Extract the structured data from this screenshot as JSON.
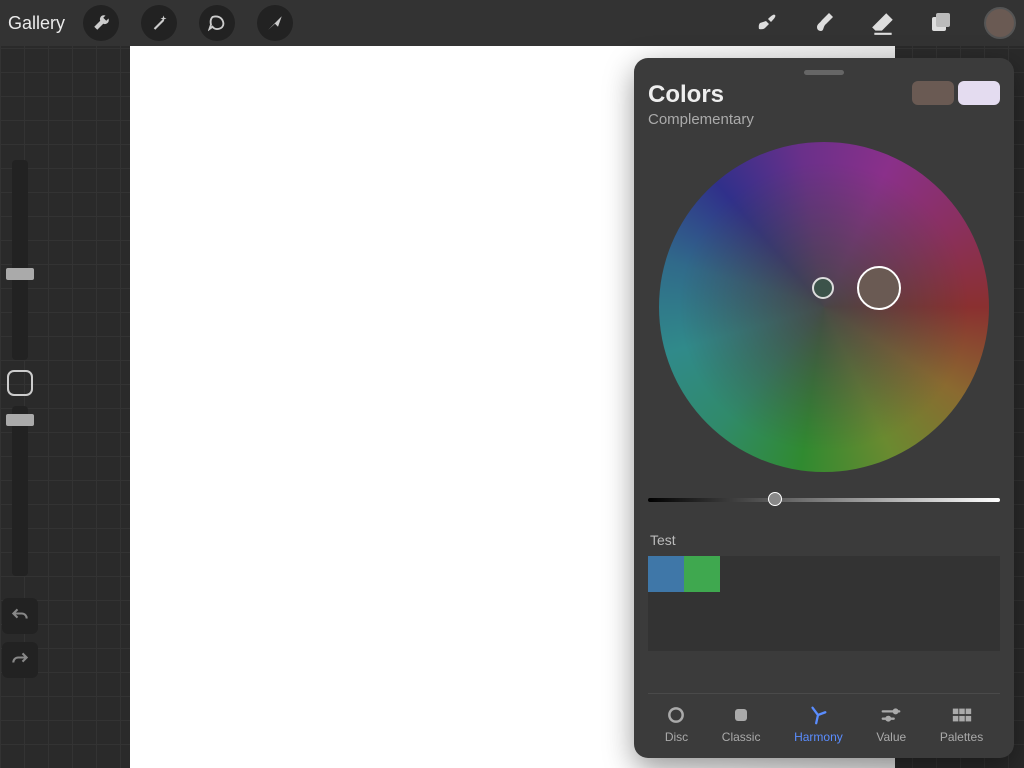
{
  "topbar": {
    "gallery_label": "Gallery",
    "left_icons": [
      "wrench-icon",
      "wand-icon",
      "selection-icon",
      "arrow-icon"
    ],
    "right_icons": [
      "brush-icon",
      "smudge-icon",
      "eraser-icon",
      "layers-icon"
    ],
    "current_color": "#6a5a53"
  },
  "color_panel": {
    "title": "Colors",
    "subtitle": "Complementary",
    "swatch_primary": "#6a5a53",
    "swatch_secondary": "#e4dcf0",
    "brightness_pct": 34,
    "palette_name": "Test",
    "palette_colors": [
      "#3f77a8",
      "#3fa84f"
    ],
    "tabs": [
      {
        "id": "disc",
        "label": "Disc"
      },
      {
        "id": "classic",
        "label": "Classic"
      },
      {
        "id": "harmony",
        "label": "Harmony"
      },
      {
        "id": "value",
        "label": "Value"
      },
      {
        "id": "palettes",
        "label": "Palettes"
      }
    ],
    "active_tab": "harmony"
  }
}
